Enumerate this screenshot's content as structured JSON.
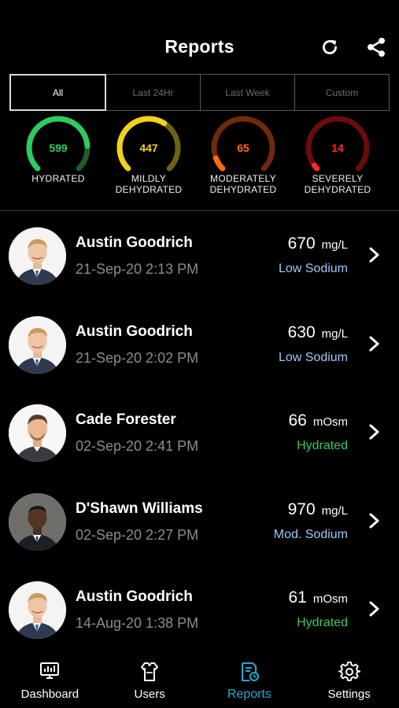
{
  "header": {
    "title": "Reports",
    "refresh_icon": "refresh-icon",
    "share_icon": "share-icon"
  },
  "filters": {
    "tabs": [
      "All",
      "Last 24Hr",
      "Last Week",
      "Custom"
    ],
    "selected": "All"
  },
  "gauges": [
    {
      "value": "599",
      "label_line1": "HYDRATED",
      "label_line2": "",
      "color": "#2ecc5f",
      "track": "#1d5e2b",
      "fraction": 0.82
    },
    {
      "value": "447",
      "label_line1": "MILDLY",
      "label_line2": "DEHYDRATED",
      "color": "#f2d21a",
      "track": "#6e6410",
      "fraction": 0.62
    },
    {
      "value": "65",
      "label_line1": "MODERATELY",
      "label_line2": "DEHYDRATED",
      "color": "#ff6a1a",
      "track": "#6e2b0c",
      "fraction": 0.09
    },
    {
      "value": "14",
      "label_line1": "SEVERELY",
      "label_line2": "DEHYDRATED",
      "color": "#ff2a2a",
      "track": "#6b0c0c",
      "fraction": 0.03
    }
  ],
  "reports": [
    {
      "name": "Austin Goodrich",
      "datetime": "21-Sep-20 2:13 PM",
      "value": "670",
      "unit": "mg/L",
      "status": "Low Sodium",
      "status_color": "#9cc9f5",
      "avatar": "avatar-austin"
    },
    {
      "name": "Austin Goodrich",
      "datetime": "21-Sep-20 2:02 PM",
      "value": "630",
      "unit": "mg/L",
      "status": "Low Sodium",
      "status_color": "#9cc9f5",
      "avatar": "avatar-austin"
    },
    {
      "name": "Cade Forester",
      "datetime": "02-Sep-20 2:41 PM",
      "value": "66",
      "unit": "mOsm",
      "status": "Hydrated",
      "status_color": "#2ecc5f",
      "avatar": "avatar-cade"
    },
    {
      "name": "D'Shawn Williams",
      "datetime": "02-Sep-20 2:27 PM",
      "value": "970",
      "unit": "mg/L",
      "status": "Mod. Sodium",
      "status_color": "#9cc9f5",
      "avatar": "avatar-dshawn"
    },
    {
      "name": "Austin Goodrich",
      "datetime": "14-Aug-20 1:38 PM",
      "value": "61",
      "unit": "mOsm",
      "status": "Hydrated",
      "status_color": "#2ecc5f",
      "avatar": "avatar-austin"
    }
  ],
  "nav": {
    "items": [
      {
        "label": "Dashboard",
        "icon": "monitor-icon"
      },
      {
        "label": "Users",
        "icon": "shirt-icon"
      },
      {
        "label": "Reports",
        "icon": "report-icon"
      },
      {
        "label": "Settings",
        "icon": "gear-icon"
      }
    ],
    "active": "Reports",
    "active_color": "#2aa7d6"
  }
}
